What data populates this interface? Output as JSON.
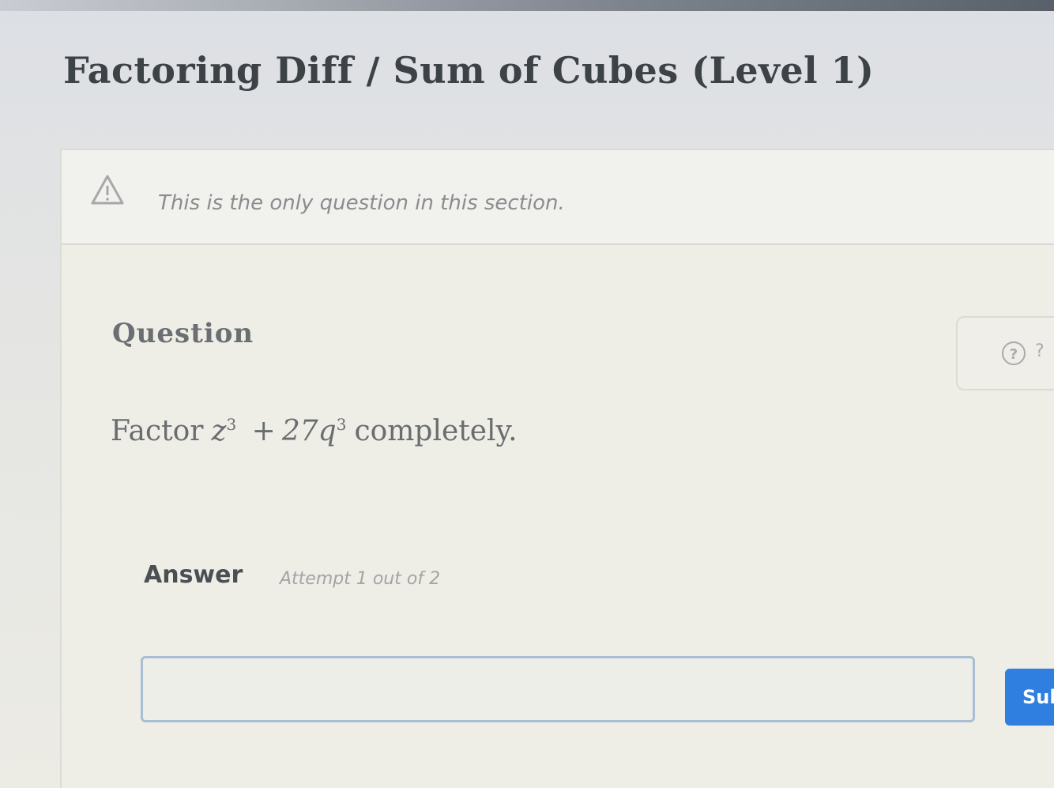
{
  "page": {
    "title": "Factoring Diff / Sum of Cubes (Level 1)"
  },
  "notice": {
    "icon": "warning-icon",
    "text": "This is the only question in this section."
  },
  "question": {
    "heading": "Question",
    "prefix": "Factor",
    "term1_base": "z",
    "term1_exp": "3",
    "operator": "+",
    "term2_base": "27q",
    "term2_exp": "3",
    "suffix": "completely."
  },
  "help": {
    "icon": "help-circle-icon",
    "icon2_glyph": "?"
  },
  "answer": {
    "label": "Answer",
    "attempt": "Attempt 1 out of 2",
    "input_value": "",
    "submit_label": "Sub"
  },
  "colors": {
    "submit": "#2f7fe0",
    "input_border": "#a9bed5"
  }
}
